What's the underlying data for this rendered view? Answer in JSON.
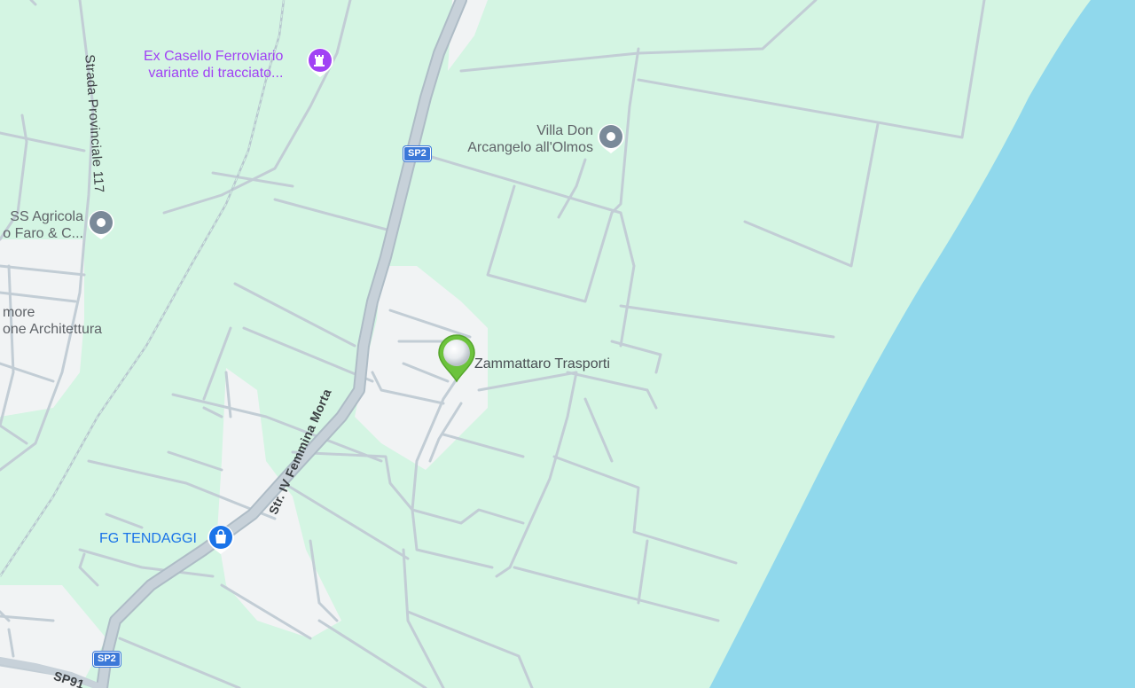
{
  "map": {
    "colors": {
      "land": "#d4f5e3",
      "urban": "#f1f3f4",
      "water": "#90d8ec",
      "road": "#c2cdd5",
      "main_road": "#c2cdd5",
      "railway": "#b8c7cf",
      "poi_gray": "#7a8a99",
      "poi_purple": "#a142f4",
      "poi_blue": "#1a73e8",
      "marker": "#6cc33c"
    },
    "pois": [
      {
        "name": "ex-casello",
        "line1": "Ex Casello Ferroviario",
        "line2": "variante di tracciato...",
        "icon": "castle-icon"
      },
      {
        "name": "villa-don",
        "line1": "Villa Don",
        "line2": "Arcangelo all'Olmos",
        "icon": "place-pin-icon"
      },
      {
        "name": "agricola",
        "line1": "SS Agricola",
        "line2": "o Faro & C...",
        "icon": "place-pin-icon"
      },
      {
        "name": "architettura",
        "line1": "more",
        "line2": "one Architettura"
      },
      {
        "name": "fg-tendaggi",
        "line1": "FG TENDAGGI",
        "icon": "shopping-bag-icon"
      }
    ],
    "marker": {
      "label": "Zammattaro Trasporti",
      "icon": "location-marker-icon"
    },
    "roads": {
      "strada_provinciale": "Strada Provinciale 117",
      "femmina_morta": "Str. IV Femmina Morta",
      "sp91": "SP91"
    },
    "shields": [
      "SP2",
      "SP2"
    ]
  }
}
